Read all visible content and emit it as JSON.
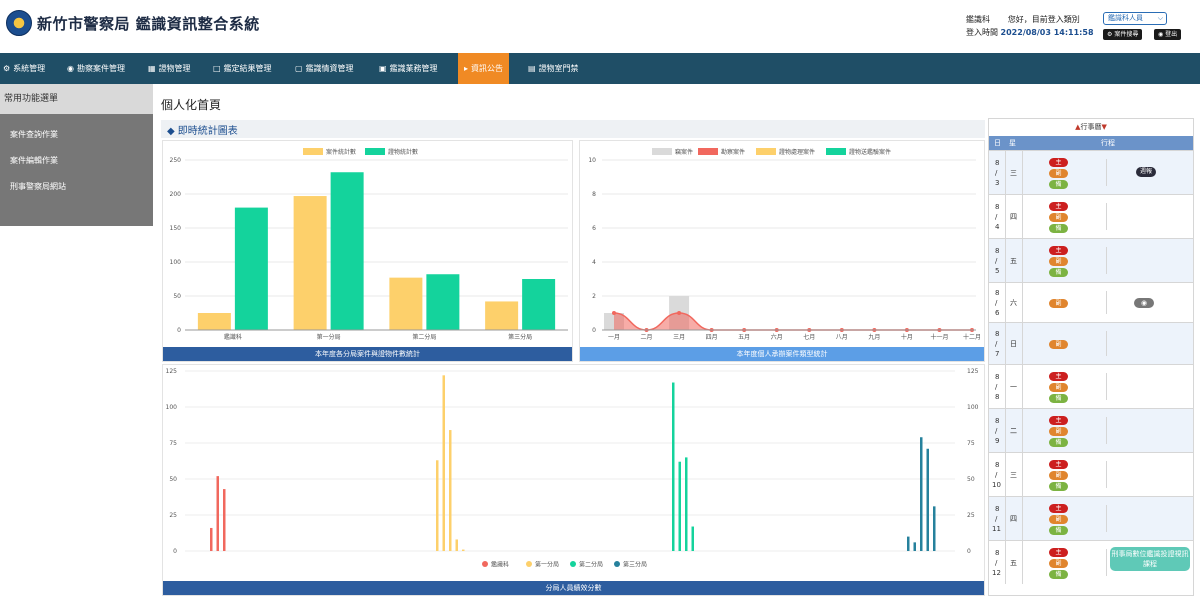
{
  "header": {
    "title": "新竹市警察局 鑑識資訊整合系統",
    "unit": "鑑識科",
    "greeting": "您好，目前登入類別",
    "login_label": "登入時間",
    "login_time": "2022/08/03 14:11:58",
    "role_select": "鑑識科人員",
    "btn_case_search": "案件搜尋",
    "btn_logout": "登出"
  },
  "nav": {
    "items": [
      "系統管理",
      "勘察案件管理",
      "證物管理",
      "鑑定結果管理",
      "鑑識情資管理",
      "鑑識業務管理",
      "資訊公告",
      "證物室門禁"
    ],
    "active": "資訊公告"
  },
  "sidebar": {
    "heading": "常用功能選單",
    "items": [
      "案件查詢作業",
      "案件編輯作業",
      "刑事警察局網站"
    ]
  },
  "main": {
    "page_title": "個人化首頁",
    "section_title": "即時統計圖表"
  },
  "chart_data": [
    {
      "type": "bar",
      "caption": "本年度各分局案件與證物件數統計",
      "categories": [
        "鑑識科",
        "第一分局",
        "第二分局",
        "第三分局"
      ],
      "series": [
        {
          "name": "案件統計數",
          "values": [
            25,
            197,
            77,
            42
          ],
          "color": "#fdd06b"
        },
        {
          "name": "證物統計數",
          "values": [
            180,
            232,
            82,
            75
          ],
          "color": "#14d39c"
        }
      ],
      "ylim": [
        0,
        250
      ],
      "yticks": [
        0,
        50,
        100,
        150,
        200,
        250
      ],
      "legend": "top"
    },
    {
      "type": "line",
      "caption": "本年度個人承辦案件類型統計",
      "categories": [
        "一月",
        "二月",
        "三月",
        "四月",
        "五月",
        "六月",
        "七月",
        "八月",
        "九月",
        "十月",
        "十一月",
        "十二月"
      ],
      "series": [
        {
          "name": "竊案件",
          "values": [
            1,
            0,
            2,
            0,
            0,
            0,
            0,
            0,
            0,
            0,
            0,
            0
          ],
          "color": "#dadada"
        },
        {
          "name": "勘察案件",
          "values": [
            1,
            0,
            1,
            0,
            0,
            0,
            0,
            0,
            0,
            0,
            0,
            0
          ],
          "color": "#f1685e"
        },
        {
          "name": "證物處理案件",
          "values": [
            0,
            0,
            0,
            0,
            0,
            0,
            0,
            0,
            0,
            0,
            0,
            0
          ],
          "color": "#fdd06b"
        },
        {
          "name": "證物送鑑驗案件",
          "values": [
            0,
            0,
            0,
            0,
            0,
            0,
            0,
            0,
            0,
            0,
            0,
            0
          ],
          "color": "#14d39c"
        }
      ],
      "ylim": [
        0,
        10
      ],
      "yticks": [
        0,
        2,
        4,
        6,
        8,
        10
      ],
      "legend": "top"
    },
    {
      "type": "bar",
      "caption": "分局人員績效分數",
      "series": [
        {
          "name": "鑑識科",
          "color": "#f1685e",
          "values": [
            16,
            52,
            43
          ]
        },
        {
          "name": "第一分局",
          "color": "#fdd06b",
          "values": [
            63,
            122,
            84,
            8,
            1
          ]
        },
        {
          "name": "第二分局",
          "color": "#14d39c",
          "values": [
            117,
            62,
            65,
            17
          ]
        },
        {
          "name": "第三分局",
          "color": "#26819c",
          "values": [
            10,
            6,
            79,
            71,
            31
          ]
        }
      ],
      "ylim": [
        0,
        125
      ],
      "yticks": [
        0,
        25,
        50,
        75,
        100,
        125
      ],
      "legend": "bottom"
    }
  ],
  "calendar": {
    "title": "行事曆",
    "col_day": "日",
    "col_week": "星",
    "col_schedule": "行程",
    "pill_labels": {
      "zhu": "主",
      "fu": "副",
      "bei": "備"
    },
    "rows": [
      {
        "month": "8",
        "day": "3",
        "week": "三",
        "pills": [
          "zhu",
          "fu",
          "bei"
        ],
        "event": "週報",
        "event_type": "dark"
      },
      {
        "month": "8",
        "day": "4",
        "week": "四",
        "pills": [
          "zhu",
          "fu",
          "bei"
        ]
      },
      {
        "month": "8",
        "day": "5",
        "week": "五",
        "pills": [
          "zhu",
          "fu",
          "bei"
        ]
      },
      {
        "month": "8",
        "day": "6",
        "week": "六",
        "pills": [
          "fu"
        ],
        "event": "cam",
        "event_type": "cam"
      },
      {
        "month": "8",
        "day": "7",
        "week": "日",
        "pills": [
          "fu"
        ]
      },
      {
        "month": "8",
        "day": "8",
        "week": "一",
        "pills": [
          "zhu",
          "fu",
          "bei"
        ]
      },
      {
        "month": "8",
        "day": "9",
        "week": "二",
        "pills": [
          "zhu",
          "fu",
          "bei"
        ]
      },
      {
        "month": "8",
        "day": "10",
        "week": "三",
        "pills": [
          "zhu",
          "fu",
          "bei"
        ]
      },
      {
        "month": "8",
        "day": "11",
        "week": "四",
        "pills": [
          "zhu",
          "fu",
          "bei"
        ]
      },
      {
        "month": "8",
        "day": "12",
        "week": "五",
        "pills": [
          "zhu",
          "fu",
          "bei"
        ],
        "event": "刑事局數位鑑識投證視訊課程",
        "event_type": "green"
      }
    ]
  },
  "colors": {
    "navbar": "#1f4e66",
    "nav_active": "#f08a24",
    "caption_dark": "#2d5d9f",
    "caption_light": "#5c9ee6"
  }
}
